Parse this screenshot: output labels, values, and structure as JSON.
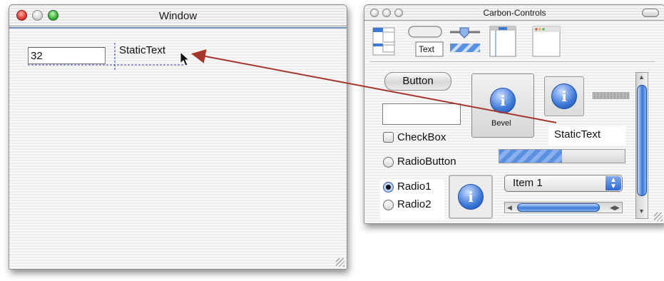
{
  "window": {
    "title": "Window",
    "text_field_value": "32",
    "static_text_label": "StaticText"
  },
  "palette": {
    "title": "Carbon-Controls",
    "toolbar_text_label": "Text",
    "button_label": "Button",
    "bevel_label": "Bevel",
    "checkbox_label": "CheckBox",
    "radio_button_label": "RadioButton",
    "static_text_label": "StaticText",
    "radio1_label": "Radio1",
    "radio2_label": "Radio2",
    "popup_label": "Item 1",
    "radio1_selected": true,
    "radio2_selected": false,
    "checkbox_checked": false,
    "progress_fraction": 0.5
  },
  "colors": {
    "arrow": "#a6352a",
    "close_light": "#e0443a",
    "minimize_light": "#e0e0e0",
    "zoom_light": "#3fb43f",
    "aqua_blue": "#3c78d8",
    "selection_dash": "#2a3fb0"
  },
  "icons": [
    "close-icon",
    "minimize-icon",
    "zoom-icon",
    "cursor-arrow-icon",
    "info-icon",
    "toolbar-collapse-icon",
    "grow-box-icon",
    "dropdown-arrows-icon",
    "scroll-arrow-up-icon",
    "scroll-arrow-down-icon",
    "scroll-arrow-left-icon",
    "scroll-arrow-right-icon"
  ]
}
